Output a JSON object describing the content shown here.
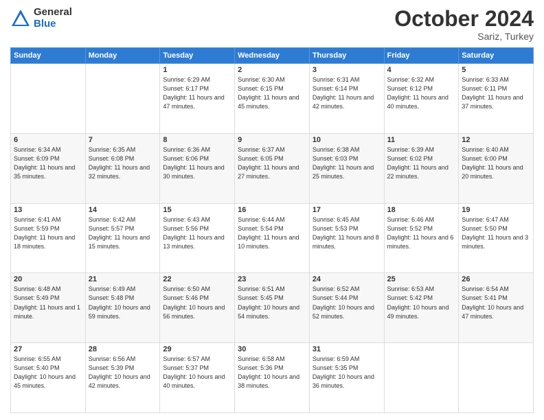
{
  "header": {
    "logo": {
      "general": "General",
      "blue": "Blue"
    },
    "title": "October 2024",
    "subtitle": "Sariz, Turkey"
  },
  "days_of_week": [
    "Sunday",
    "Monday",
    "Tuesday",
    "Wednesday",
    "Thursday",
    "Friday",
    "Saturday"
  ],
  "weeks": [
    [
      {
        "day": "",
        "info": ""
      },
      {
        "day": "",
        "info": ""
      },
      {
        "day": "1",
        "info": "Sunrise: 6:29 AM\nSunset: 6:17 PM\nDaylight: 11 hours and 47 minutes."
      },
      {
        "day": "2",
        "info": "Sunrise: 6:30 AM\nSunset: 6:15 PM\nDaylight: 11 hours and 45 minutes."
      },
      {
        "day": "3",
        "info": "Sunrise: 6:31 AM\nSunset: 6:14 PM\nDaylight: 11 hours and 42 minutes."
      },
      {
        "day": "4",
        "info": "Sunrise: 6:32 AM\nSunset: 6:12 PM\nDaylight: 11 hours and 40 minutes."
      },
      {
        "day": "5",
        "info": "Sunrise: 6:33 AM\nSunset: 6:11 PM\nDaylight: 11 hours and 37 minutes."
      }
    ],
    [
      {
        "day": "6",
        "info": "Sunrise: 6:34 AM\nSunset: 6:09 PM\nDaylight: 11 hours and 35 minutes."
      },
      {
        "day": "7",
        "info": "Sunrise: 6:35 AM\nSunset: 6:08 PM\nDaylight: 11 hours and 32 minutes."
      },
      {
        "day": "8",
        "info": "Sunrise: 6:36 AM\nSunset: 6:06 PM\nDaylight: 11 hours and 30 minutes."
      },
      {
        "day": "9",
        "info": "Sunrise: 6:37 AM\nSunset: 6:05 PM\nDaylight: 11 hours and 27 minutes."
      },
      {
        "day": "10",
        "info": "Sunrise: 6:38 AM\nSunset: 6:03 PM\nDaylight: 11 hours and 25 minutes."
      },
      {
        "day": "11",
        "info": "Sunrise: 6:39 AM\nSunset: 6:02 PM\nDaylight: 11 hours and 22 minutes."
      },
      {
        "day": "12",
        "info": "Sunrise: 6:40 AM\nSunset: 6:00 PM\nDaylight: 11 hours and 20 minutes."
      }
    ],
    [
      {
        "day": "13",
        "info": "Sunrise: 6:41 AM\nSunset: 5:59 PM\nDaylight: 11 hours and 18 minutes."
      },
      {
        "day": "14",
        "info": "Sunrise: 6:42 AM\nSunset: 5:57 PM\nDaylight: 11 hours and 15 minutes."
      },
      {
        "day": "15",
        "info": "Sunrise: 6:43 AM\nSunset: 5:56 PM\nDaylight: 11 hours and 13 minutes."
      },
      {
        "day": "16",
        "info": "Sunrise: 6:44 AM\nSunset: 5:54 PM\nDaylight: 11 hours and 10 minutes."
      },
      {
        "day": "17",
        "info": "Sunrise: 6:45 AM\nSunset: 5:53 PM\nDaylight: 11 hours and 8 minutes."
      },
      {
        "day": "18",
        "info": "Sunrise: 6:46 AM\nSunset: 5:52 PM\nDaylight: 11 hours and 6 minutes."
      },
      {
        "day": "19",
        "info": "Sunrise: 6:47 AM\nSunset: 5:50 PM\nDaylight: 11 hours and 3 minutes."
      }
    ],
    [
      {
        "day": "20",
        "info": "Sunrise: 6:48 AM\nSunset: 5:49 PM\nDaylight: 11 hours and 1 minute."
      },
      {
        "day": "21",
        "info": "Sunrise: 6:49 AM\nSunset: 5:48 PM\nDaylight: 10 hours and 59 minutes."
      },
      {
        "day": "22",
        "info": "Sunrise: 6:50 AM\nSunset: 5:46 PM\nDaylight: 10 hours and 56 minutes."
      },
      {
        "day": "23",
        "info": "Sunrise: 6:51 AM\nSunset: 5:45 PM\nDaylight: 10 hours and 54 minutes."
      },
      {
        "day": "24",
        "info": "Sunrise: 6:52 AM\nSunset: 5:44 PM\nDaylight: 10 hours and 52 minutes."
      },
      {
        "day": "25",
        "info": "Sunrise: 6:53 AM\nSunset: 5:42 PM\nDaylight: 10 hours and 49 minutes."
      },
      {
        "day": "26",
        "info": "Sunrise: 6:54 AM\nSunset: 5:41 PM\nDaylight: 10 hours and 47 minutes."
      }
    ],
    [
      {
        "day": "27",
        "info": "Sunrise: 6:55 AM\nSunset: 5:40 PM\nDaylight: 10 hours and 45 minutes."
      },
      {
        "day": "28",
        "info": "Sunrise: 6:56 AM\nSunset: 5:39 PM\nDaylight: 10 hours and 42 minutes."
      },
      {
        "day": "29",
        "info": "Sunrise: 6:57 AM\nSunset: 5:37 PM\nDaylight: 10 hours and 40 minutes."
      },
      {
        "day": "30",
        "info": "Sunrise: 6:58 AM\nSunset: 5:36 PM\nDaylight: 10 hours and 38 minutes."
      },
      {
        "day": "31",
        "info": "Sunrise: 6:59 AM\nSunset: 5:35 PM\nDaylight: 10 hours and 36 minutes."
      },
      {
        "day": "",
        "info": ""
      },
      {
        "day": "",
        "info": ""
      }
    ]
  ]
}
